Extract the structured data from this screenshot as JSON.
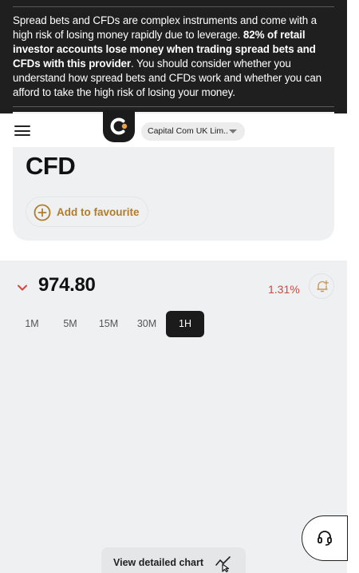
{
  "risk_warning": {
    "text_start": "Spread bets and CFDs are complex instruments and come with a high risk of losing money rapidly due to leverage. ",
    "text_bold": "82% of retail investor accounts lose money when trading spread bets and CFDs with this provider",
    "text_end": ". You should consider whether you understand how spread bets and CFDs work and whether you can afford to take the high risk of losing your money."
  },
  "header": {
    "menu_icon": "hamburger-menu-icon",
    "logo_icon": "capital-com-logo",
    "entity_selector": "Capital Com UK Lim..."
  },
  "instrument": {
    "title": "CFD",
    "favourite_label": "Add to favourite"
  },
  "quote": {
    "direction_icon": "chevron-down-icon",
    "price": "974.80",
    "change": "1.31%",
    "change_color": "#d4463c",
    "alert_icon": "bell-plus-icon"
  },
  "timeframes": {
    "items": [
      "1M",
      "5M",
      "15M",
      "30M",
      "1H"
    ],
    "selected": "1H"
  },
  "chart_button": {
    "label": "View detailed chart",
    "icon": "chart-cursor-icon"
  },
  "support": {
    "icon": "headset-icon"
  },
  "colors": {
    "banner_bg": "#1f1f1f",
    "accent_gold": "#b07c2e",
    "negative": "#d4463c",
    "active_tab": "#1b1b1b",
    "panel_bg": "#eef0f1"
  }
}
